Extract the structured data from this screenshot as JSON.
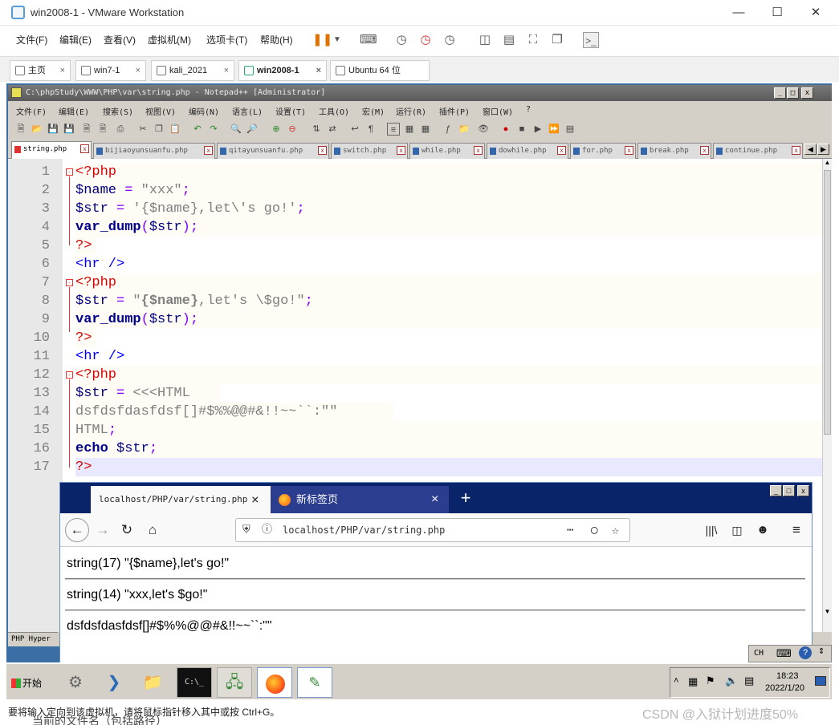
{
  "vmware": {
    "window_title": "win2008-1 - VMware Workstation",
    "menu": [
      "文件(F)",
      "编辑(E)",
      "查看(V)",
      "虚拟机(M)",
      "选项卡(T)",
      "帮助(H)"
    ],
    "tabs": [
      {
        "label": "主页",
        "active": false
      },
      {
        "label": "win7-1",
        "active": false
      },
      {
        "label": "kali_2021",
        "active": false
      },
      {
        "label": "win2008-1",
        "active": true
      },
      {
        "label": "Ubuntu 64 位",
        "active": false
      }
    ],
    "status_message": "要将输入定向到该虚拟机，请将鼠标指针移入其中或按 Ctrl+G。",
    "watermark": "CSDN @入狱计划进度50%",
    "bottom_cut_text": "当前的文件名（包括路径）",
    "tab_close": "×"
  },
  "notepad": {
    "title": "C:\\phpStudy\\WWW\\PHP\\var\\string.php - Notepad++ [Administrator]",
    "menu": [
      "文件(F)",
      "编辑(E)",
      "搜索(S)",
      "视图(V)",
      "编码(N)",
      "语言(L)",
      "设置(T)",
      "工具(O)",
      "宏(M)",
      "运行(R)",
      "插件(P)",
      "窗口(W)",
      "?"
    ],
    "doc_tabs": [
      "string.php",
      "bijiaoyunsuanfu.php",
      "qitayunsuanfu.php",
      "switch.php",
      "while.php",
      "dowhile.php",
      "for.php",
      "break.php",
      "continue.php"
    ],
    "line_numbers": [
      "1",
      "2",
      "3",
      "4",
      "5",
      "6",
      "7",
      "8",
      "9",
      "10",
      "11",
      "12",
      "13",
      "14",
      "15",
      "16",
      "17"
    ],
    "lang_label": "PHP Hyper"
  },
  "code": {
    "l1": "<?php",
    "l2_var": "$name",
    "l2_eq": " = ",
    "l2_str": "\"xxx\"",
    "l2_end": ";",
    "l3_var": "$str",
    "l3_eq": " = ",
    "l3_str": "'{$name},let\\'s go!'",
    "l3_end": ";",
    "l4_fn": "var_dump",
    "l4_open": "(",
    "l4_arg": "$str",
    "l4_close": ");",
    "l5": "?>",
    "l6": "<hr />",
    "l7": "<?php",
    "l8_var": "$str",
    "l8_eq": " = ",
    "l8_q1": "\"",
    "l8_interp": "{$name}",
    "l8_rest": ",let's \\$go!\"",
    "l8_end": ";",
    "l9_fn": "var_dump",
    "l9_open": "(",
    "l9_arg": "$str",
    "l9_close": ");",
    "l10": "?>",
    "l11": "<hr />",
    "l12": "<?php",
    "l13_var": "$str",
    "l13_eq": " = ",
    "l13_heredoc": "<<<HTML",
    "l14": "dsfdsfdasfdsf[]#$%%@@#&!!~~``:\"\"",
    "l15_str": "HTML",
    "l15_end": ";",
    "l16_kw": "echo",
    "l16_var": " $str",
    "l16_end": ";",
    "l17": "?>"
  },
  "firefox": {
    "tab1_title": "localhost/PHP/var/string.php",
    "tab2_title": "新标签页",
    "url": "localhost/PHP/var/string.php",
    "output": [
      "string(17) \"{$name},let's go!\"",
      "string(14) \"xxx,let's $go!\"",
      "dsfdsfdasfdsf[]#$%%@@#&!!~~``:\"\""
    ],
    "new_tab_symbol": "+",
    "tab_close": "×"
  },
  "taskbar": {
    "start_label": "开始",
    "time": "18:23",
    "date": "2022/1/20",
    "ime": "CH"
  }
}
